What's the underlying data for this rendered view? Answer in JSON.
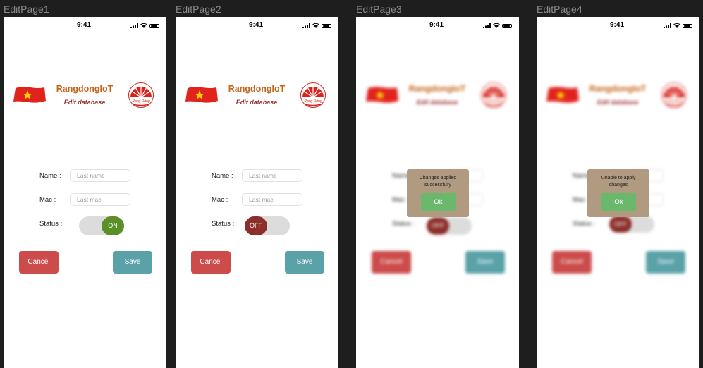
{
  "frames": [
    {
      "label": "EditPage1",
      "time": "9:41",
      "app_title": "RangdongIoT",
      "subtitle": "Edit database",
      "name_label": "Name :",
      "name_placeholder": "Last name",
      "mac_label": "Mac :",
      "mac_placeholder": "Last mac",
      "status_label": "Status :",
      "toggle_text": "ON",
      "toggle_state": "on",
      "cancel_label": "Cancel",
      "save_label": "Save"
    },
    {
      "label": "EditPage2",
      "time": "9:41",
      "app_title": "RangdongIoT",
      "subtitle": "Edit database",
      "name_label": "Name :",
      "name_placeholder": "Last name",
      "mac_label": "Mac :",
      "mac_placeholder": "Last mac",
      "status_label": "Status :",
      "toggle_text": "OFF",
      "toggle_state": "off",
      "cancel_label": "Cancel",
      "save_label": "Save"
    },
    {
      "label": "EditPage3",
      "time": "9:41",
      "app_title": "RangdongIoT",
      "subtitle": "Edit database",
      "name_label": "Name :",
      "name_placeholder": "",
      "mac_label": "Mac :",
      "mac_placeholder": "",
      "status_label": "Status :",
      "toggle_text": "OFF",
      "toggle_state": "off",
      "cancel_label": "Cancel",
      "save_label": "Save",
      "dialog": {
        "line1": "Changes applied",
        "line2": "successfully",
        "ok_label": "Ok"
      }
    },
    {
      "label": "EditPage4",
      "time": "9:41",
      "app_title": "RangdongIoT",
      "subtitle": "Edit database",
      "name_label": "Name :",
      "name_placeholder": "",
      "mac_label": "Mac :",
      "mac_placeholder": "",
      "status_label": "Status :",
      "toggle_text": "OFF",
      "toggle_state": "off",
      "cancel_label": "Cancel",
      "save_label": "Save",
      "dialog": {
        "line1": "Unable to apply",
        "line2": "changes",
        "ok_label": "Ok"
      }
    }
  ],
  "logo_text": "Rạng Đông",
  "colors": {
    "canvas": "#1e1e1e",
    "title": "#c4661a",
    "subtitle": "#9e2e2e",
    "toggle_on": "#5b8f27",
    "toggle_off": "#8c2e2a",
    "cancel": "#cc4b4b",
    "save": "#5aa2a8",
    "dialog": "#b09a80",
    "ok": "#69b86c",
    "logo_red": "#d8241c"
  },
  "icons": [
    "signal-icon",
    "wifi-icon",
    "battery-icon",
    "vietnam-flag-icon",
    "rangdong-logo-icon"
  ]
}
